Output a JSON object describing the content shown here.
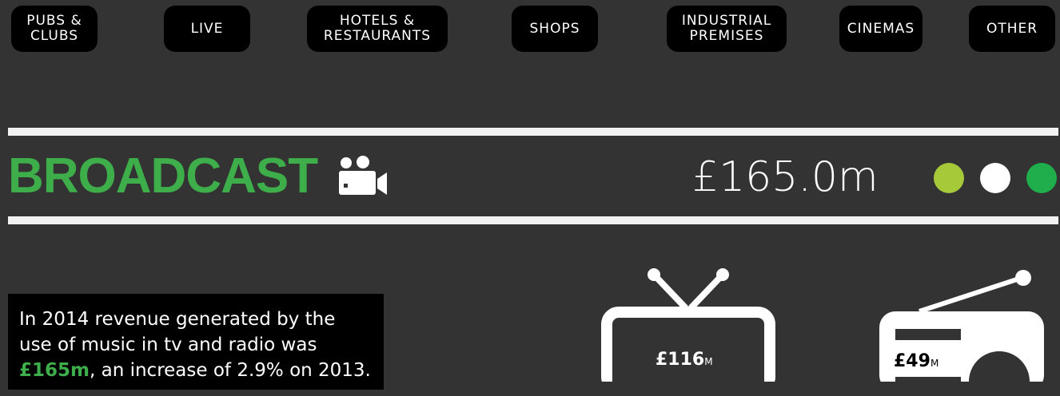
{
  "nav": [
    {
      "label": "PUBS &\nCLUBS"
    },
    {
      "label": "LIVE"
    },
    {
      "label": "HOTELS &\nRESTAURANTS"
    },
    {
      "label": "SHOPS"
    },
    {
      "label": "INDUSTRIAL\nPREMISES"
    },
    {
      "label": "CINEMAS"
    },
    {
      "label": "OTHER"
    }
  ],
  "section": {
    "title": "BROADCAST",
    "icon": "camera-icon",
    "amount": "£165.0m",
    "dot_colors": [
      "#a6c93a",
      "#ffffff",
      "#1fae4b"
    ]
  },
  "summary": {
    "text_before": "In 2014 revenue generated by the use of music in tv and radio was ",
    "highlight": "£165m",
    "text_after": ", an increase of 2.9% on 2013."
  },
  "tv": {
    "icon": "tv-icon",
    "value": "£116",
    "unit": "M"
  },
  "radio": {
    "icon": "radio-icon",
    "value": "£49",
    "unit": "M"
  },
  "colors": {
    "accent": "#3dae49",
    "background": "#333333"
  }
}
